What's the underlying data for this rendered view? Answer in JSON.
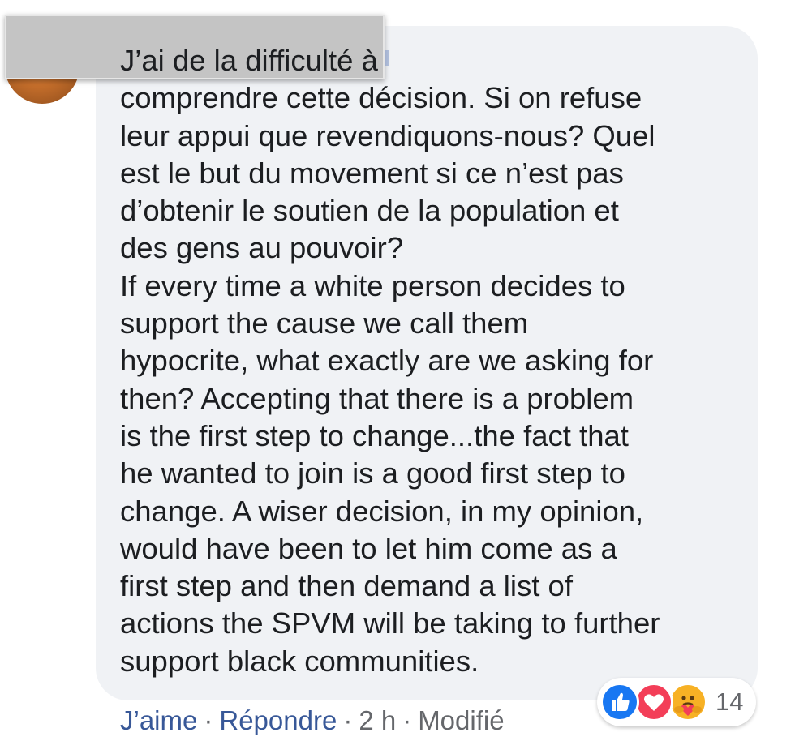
{
  "comment": {
    "text": "J’ai de la difficulté à\ncomprendre cette décision. Si on refuse\nleur appui que revendiquons-nous? Quel\nest le but du movement si ce n’est pas\nd’obtenir le soutien de la population et\ndes gens au pouvoir?\nIf every time a white person decides to\nsupport the cause we call them\nhypocrite, what exactly are we asking for\nthen? Accepting that there is a problem\nis the first step to change...the fact that\nhe wanted to join is a good first step to\nchange. A wiser decision, in my opinion,\nwould have been to let him come as a\nfirst step and then demand a list of\nactions the SPVM will be taking to further\nsupport black communities."
  },
  "actions": {
    "like": "J’aime",
    "reply": "Répondre",
    "time": "2 h",
    "edited": "Modifié",
    "separator": "·"
  },
  "reactions": {
    "count": "14",
    "icons": [
      "like-icon",
      "love-icon",
      "care-icon"
    ]
  },
  "colors": {
    "bubble_bg": "#f0f2f5",
    "text": "#1c1e21",
    "link": "#385898",
    "meta": "#65676b",
    "like": "#1877f2",
    "love": "#f33e58",
    "care": "#f7b125"
  }
}
